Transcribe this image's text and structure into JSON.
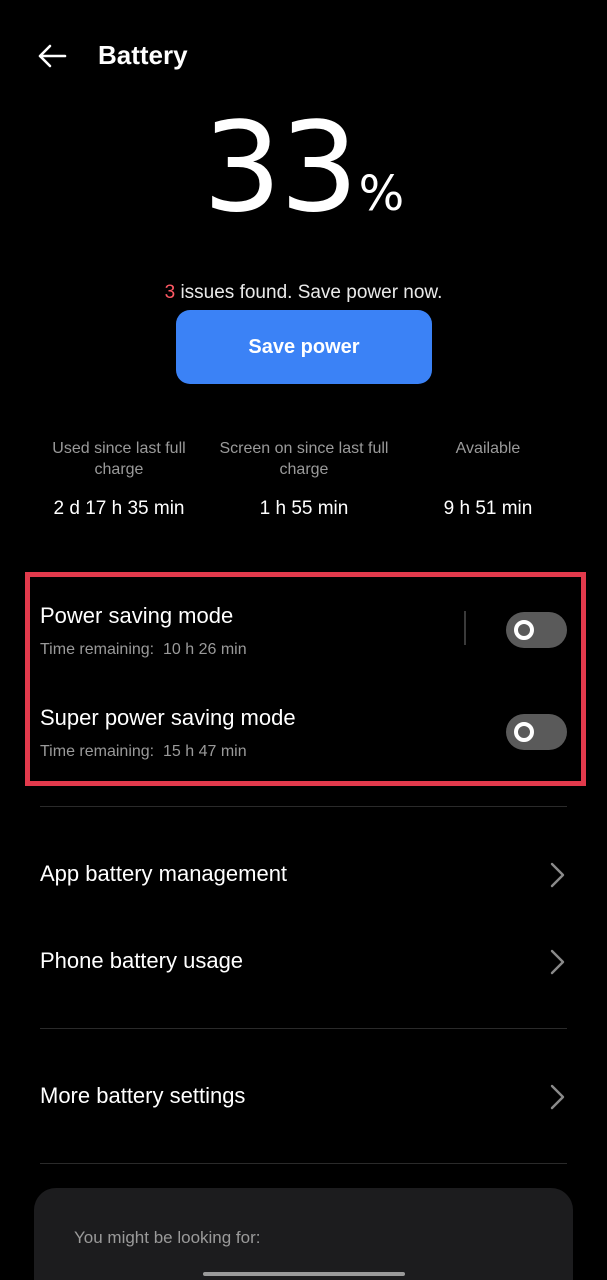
{
  "header": {
    "title": "Battery",
    "back_icon": "arrow-left-icon"
  },
  "battery": {
    "level": "33",
    "unit": "%"
  },
  "issues": {
    "count": "3",
    "text": " issues found. Save power now."
  },
  "save_button": {
    "label": "Save power"
  },
  "stats": [
    {
      "label": "Used since last full charge",
      "value": "2 d 17 h 35 min"
    },
    {
      "label": "Screen on since last full charge",
      "value": "1 h 55 min"
    },
    {
      "label": "Available",
      "value": "9 h 51 min"
    }
  ],
  "modes": [
    {
      "title": "Power saving mode",
      "subtitle": "Time remaining:  10 h 26 min",
      "enabled": false
    },
    {
      "title": "Super power saving mode",
      "subtitle": "Time remaining:  15 h 47 min",
      "enabled": false
    }
  ],
  "menu": [
    {
      "label": "App battery management",
      "icon": "chevron-right-icon"
    },
    {
      "label": "Phone battery usage",
      "icon": "chevron-right-icon"
    },
    {
      "label": "More battery settings",
      "icon": "chevron-right-icon"
    }
  ],
  "suggestions": {
    "title": "You might be looking for:"
  },
  "colors": {
    "accent": "#3b82f6",
    "issue_count": "#ff5964",
    "highlight_border": "#e23a4c",
    "background": "#000000"
  }
}
